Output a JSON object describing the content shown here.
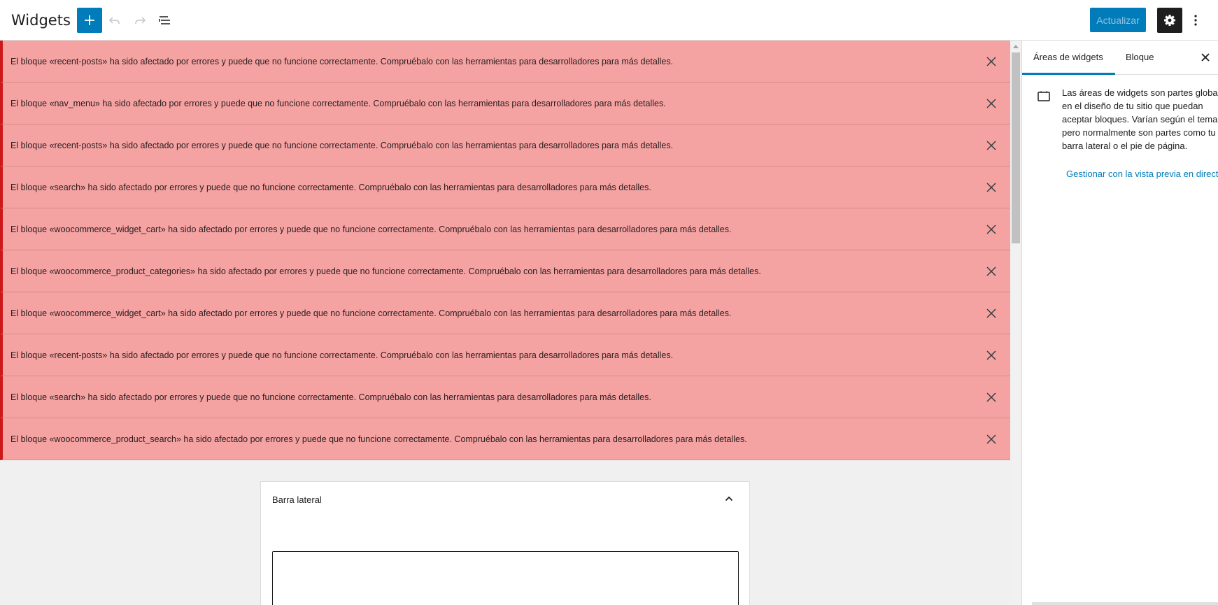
{
  "header": {
    "title": "Widgets",
    "update_label": "Actualizar"
  },
  "notices": [
    {
      "text": "El bloque «recent-posts» ha sido afectado por errores y puede que no funcione correctamente. Compruébalo con las herramientas para desarrolladores para más detalles."
    },
    {
      "text": "El bloque «nav_menu» ha sido afectado por errores y puede que no funcione correctamente. Compruébalo con las herramientas para desarrolladores para más detalles."
    },
    {
      "text": "El bloque «recent-posts» ha sido afectado por errores y puede que no funcione correctamente. Compruébalo con las herramientas para desarrolladores para más detalles."
    },
    {
      "text": "El bloque «search» ha sido afectado por errores y puede que no funcione correctamente. Compruébalo con las herramientas para desarrolladores para más detalles."
    },
    {
      "text": "El bloque «woocommerce_widget_cart» ha sido afectado por errores y puede que no funcione correctamente. Compruébalo con las herramientas para desarrolladores para más detalles."
    },
    {
      "text": "El bloque «woocommerce_product_categories» ha sido afectado por errores y puede que no funcione correctamente. Compruébalo con las herramientas para desarrolladores para más detalles."
    },
    {
      "text": "El bloque «woocommerce_widget_cart» ha sido afectado por errores y puede que no funcione correctamente. Compruébalo con las herramientas para desarrolladores para más detalles."
    },
    {
      "text": "El bloque «recent-posts» ha sido afectado por errores y puede que no funcione correctamente. Compruébalo con las herramientas para desarrolladores para más detalles."
    },
    {
      "text": "El bloque «search» ha sido afectado por errores y puede que no funcione correctamente. Compruébalo con las herramientas para desarrolladores para más detalles."
    },
    {
      "text": "El bloque «woocommerce_product_search» ha sido afectado por errores y puede que no funcione correctamente. Compruébalo con las herramientas para desarrolladores para más detalles."
    }
  ],
  "widget_area": {
    "title": "Barra lateral"
  },
  "sidebar": {
    "tabs": [
      {
        "label": "Áreas de widgets"
      },
      {
        "label": "Bloque"
      }
    ],
    "description": "Las áreas de widgets son partes globales en el diseño de tu sitio que puedan aceptar bloques. Varían según el tema, pero normalmente son partes como tu barra lateral o el pie de página.",
    "link_label": "Gestionar con la vista previa en directo"
  },
  "colors": {
    "accent": "#007cba",
    "notice_bg": "#f4a2a2",
    "notice_border": "#cc1818"
  }
}
